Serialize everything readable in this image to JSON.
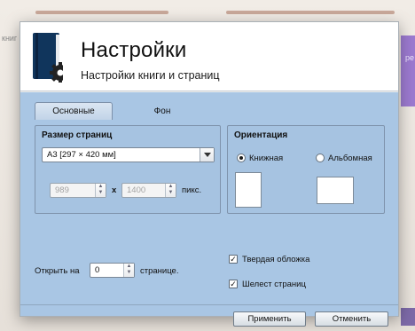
{
  "background": {
    "side_text": "книг",
    "right_text": "ре"
  },
  "dialog": {
    "title": "Настройки",
    "subtitle": "Настройки книги и страниц",
    "tabs": [
      {
        "label": "Основные",
        "active": true
      },
      {
        "label": "Фон",
        "active": false
      }
    ],
    "page_size": {
      "group_title": "Размер страниц",
      "selected": "А3 [297 × 420 мм]",
      "width": "989",
      "separator": "x",
      "height": "1400",
      "unit": "пикс."
    },
    "orientation": {
      "group_title": "Ориентация",
      "portrait_label": "Книжная",
      "portrait_selected": true,
      "landscape_label": "Альбомная",
      "landscape_selected": false
    },
    "open_on": {
      "prefix": "Открыть на",
      "value": "0",
      "suffix": "странице."
    },
    "options": {
      "hard_cover_label": "Твердая обложка",
      "hard_cover_checked": true,
      "page_flip_sound_label": "Шелест страниц",
      "page_flip_sound_checked": true
    },
    "buttons": {
      "apply": "Применить",
      "cancel": "Отменить"
    }
  },
  "colors": {
    "content_bg": "#a9c6e4",
    "header_bg": "#ffffff",
    "bg_accent": "#9c7ad0"
  }
}
